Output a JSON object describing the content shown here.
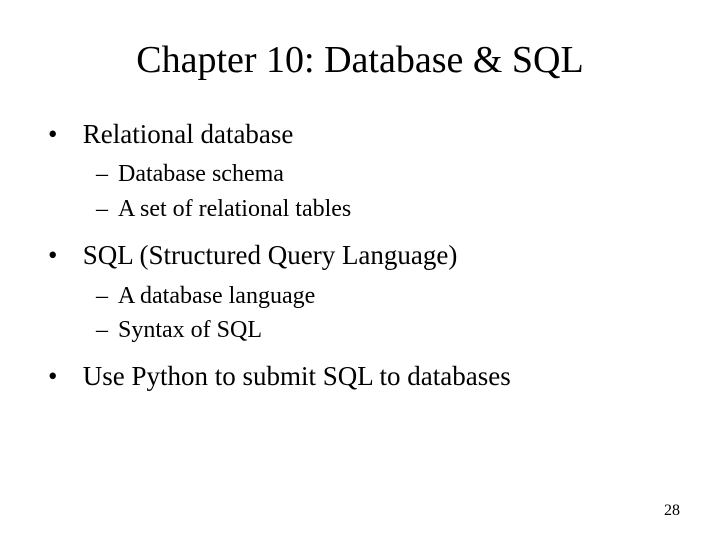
{
  "title": "Chapter 10: Database & SQL",
  "bullets": {
    "b0": {
      "text": "Relational database",
      "sub": {
        "s0": "Database schema",
        "s1": "A set of relational tables"
      }
    },
    "b1": {
      "text": "SQL (Structured Query Language)",
      "sub": {
        "s0": "A database language",
        "s1": "Syntax of SQL"
      }
    },
    "b2": {
      "text": "Use Python to submit SQL to databases"
    }
  },
  "page_number": "28"
}
